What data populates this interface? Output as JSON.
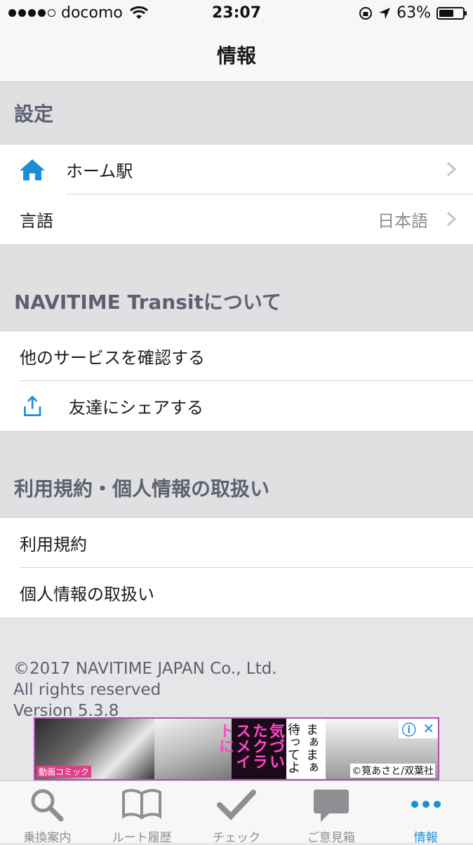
{
  "status_bar": {
    "carrier": "docomo",
    "time": "23:07",
    "battery_percent": "63%",
    "battery_level": 0.63,
    "signal_bars": 4
  },
  "nav": {
    "title": "情報"
  },
  "sections": {
    "settings": {
      "header": "設定",
      "home_station": {
        "label": "ホーム駅",
        "icon": "home-icon"
      },
      "language": {
        "label": "言語",
        "value": "日本語"
      }
    },
    "about": {
      "header": "NAVITIME Transitについて",
      "other_services": {
        "label": "他のサービスを確認する"
      },
      "share": {
        "label": "友達にシェアする",
        "icon": "share-icon"
      }
    },
    "terms": {
      "header": "利用規約・個人情報の取扱い",
      "terms_of_use": {
        "label": "利用規約"
      },
      "privacy": {
        "label": "個人情報の取扱い"
      }
    }
  },
  "footer": {
    "copyright": "©2017 NAVITIME JAPAN Co., Ltd.",
    "rights": "All rights reserved",
    "version": "Version 5.3.8"
  },
  "ad": {
    "headline": "気づいたクラスメイトに",
    "speech": "まぁまぁ待ってよ",
    "credit": "©筧あさと/双葉社",
    "badge": "動画コミック"
  },
  "tabs": [
    {
      "label": "乗換案内",
      "icon": "search-icon",
      "active": false
    },
    {
      "label": "ルート履歴",
      "icon": "book-icon",
      "active": false
    },
    {
      "label": "チェック",
      "icon": "check-icon",
      "active": false
    },
    {
      "label": "ご意見箱",
      "icon": "speech-bubble-icon",
      "active": false
    },
    {
      "label": "情報",
      "icon": "more-icon",
      "active": true
    }
  ],
  "colors": {
    "accent": "#1a8fd8",
    "section_bg": "#e0e0e2",
    "section_text": "#5c6170"
  }
}
